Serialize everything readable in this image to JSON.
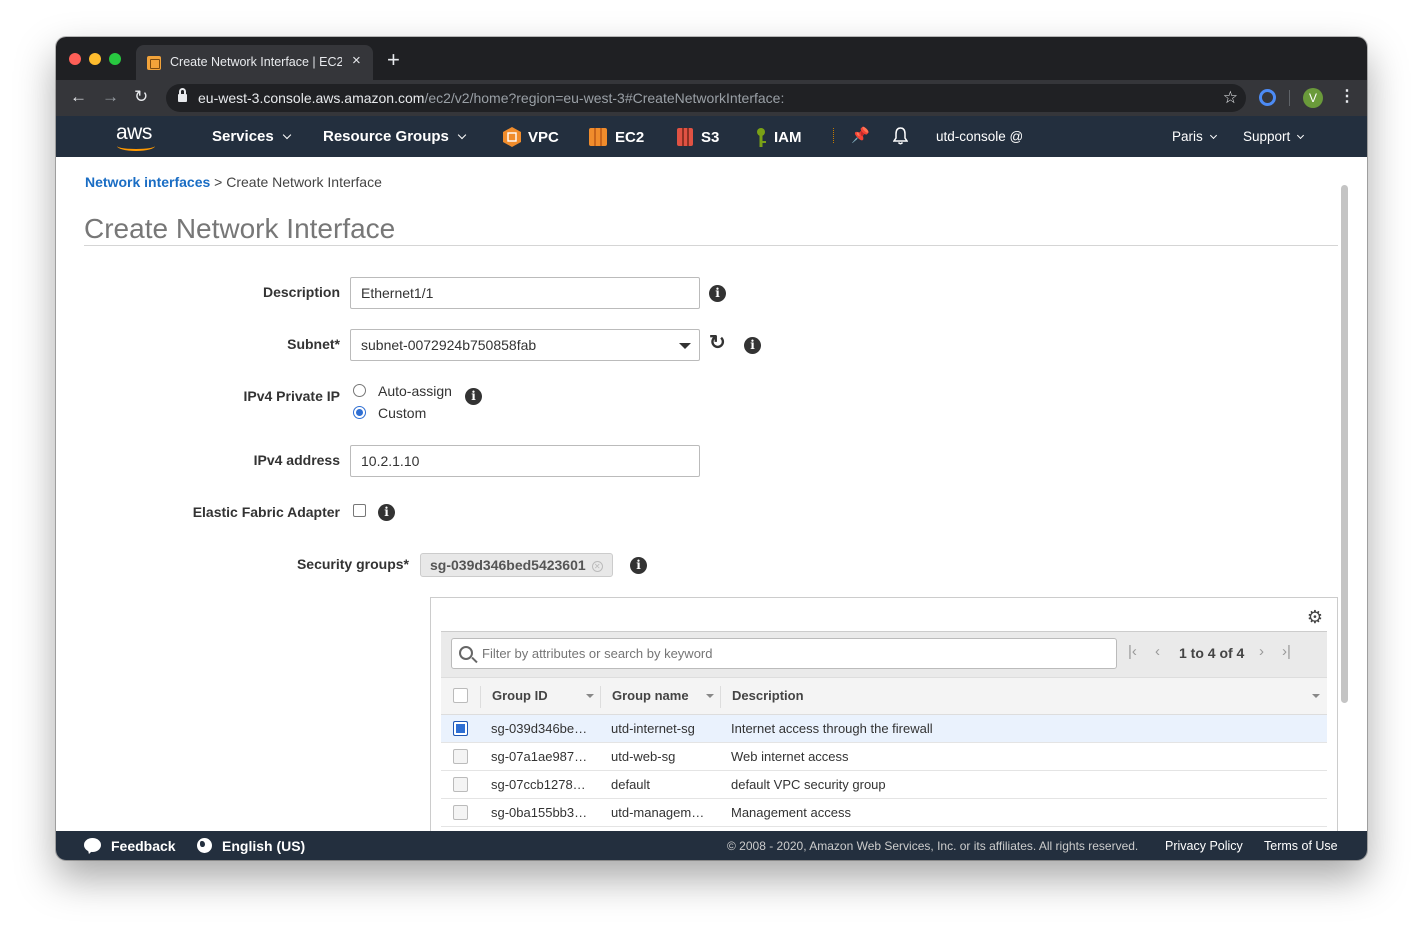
{
  "browser": {
    "tab_title": "Create Network Interface | EC2",
    "tab_close": "×",
    "new_tab": "+",
    "url_host": "eu-west-3.console.aws.amazon.com",
    "url_path": "/ec2/v2/home?region=eu-west-3#CreateNetworkInterface:",
    "avatar_initial": "V"
  },
  "aws_nav": {
    "logo_text": "aws",
    "services": "Services",
    "resource_groups": "Resource Groups",
    "shortcuts": [
      {
        "label": "VPC",
        "color": "#f08c2c"
      },
      {
        "label": "EC2",
        "color": "#f08c2c"
      },
      {
        "label": "S3",
        "color": "#e05243"
      },
      {
        "label": "IAM",
        "color": "#7aa116"
      }
    ],
    "account": "utd-console @",
    "region": "Paris",
    "support": "Support"
  },
  "breadcrumb": {
    "link": "Network interfaces",
    "separator": " > ",
    "current": "Create Network Interface"
  },
  "page_title": "Create Network Interface",
  "form": {
    "description_label": "Description",
    "description_value": "Ethernet1/1",
    "subnet_label": "Subnet*",
    "subnet_value": "subnet-0072924b750858fab",
    "ipv4_private_ip_label": "IPv4 Private IP",
    "auto_assign_label": "Auto-assign",
    "custom_label": "Custom",
    "ipv4_private_ip_selected": "Custom",
    "ipv4_address_label": "IPv4 address",
    "ipv4_address_value": "10.2.1.10",
    "efa_label": "Elastic Fabric Adapter",
    "efa_checked": false,
    "security_groups_label": "Security groups*",
    "security_group_token": "sg-039d346bed5423601"
  },
  "sg_table": {
    "filter_placeholder": "Filter by attributes or search by keyword",
    "pager_text": "1 to 4 of 4",
    "columns": [
      "Group ID",
      "Group name",
      "Description"
    ],
    "rows": [
      {
        "group_id": "sg-039d346be…",
        "group_name": "utd-internet-sg",
        "description": "Internet access through the firewall",
        "selected": true
      },
      {
        "group_id": "sg-07a1ae987…",
        "group_name": "utd-web-sg",
        "description": "Web internet access",
        "selected": false
      },
      {
        "group_id": "sg-07ccb1278…",
        "group_name": "default",
        "description": "default VPC security group",
        "selected": false
      },
      {
        "group_id": "sg-0ba155bb3…",
        "group_name": "utd-managem…",
        "description": "Management access",
        "selected": false
      }
    ]
  },
  "footer": {
    "feedback": "Feedback",
    "language": "English (US)",
    "copyright": "© 2008 - 2020, Amazon Web Services, Inc. or its affiliates. All rights reserved.",
    "privacy": "Privacy Policy",
    "terms": "Terms of Use"
  }
}
